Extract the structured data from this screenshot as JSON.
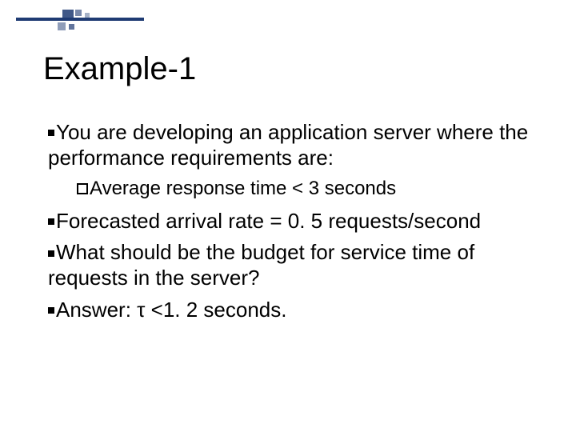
{
  "title": "Example-1",
  "items": [
    {
      "text": "You are developing an application server where the performance requirements are:",
      "sub": [
        {
          "text": "Average response time < 3 seconds"
        }
      ]
    },
    {
      "text": "Forecasted arrival rate = 0. 5 requests/second"
    },
    {
      "text": "What should be the budget for service time of requests in the server?"
    },
    {
      "text": "Answer: τ <1. 2 seconds."
    }
  ]
}
